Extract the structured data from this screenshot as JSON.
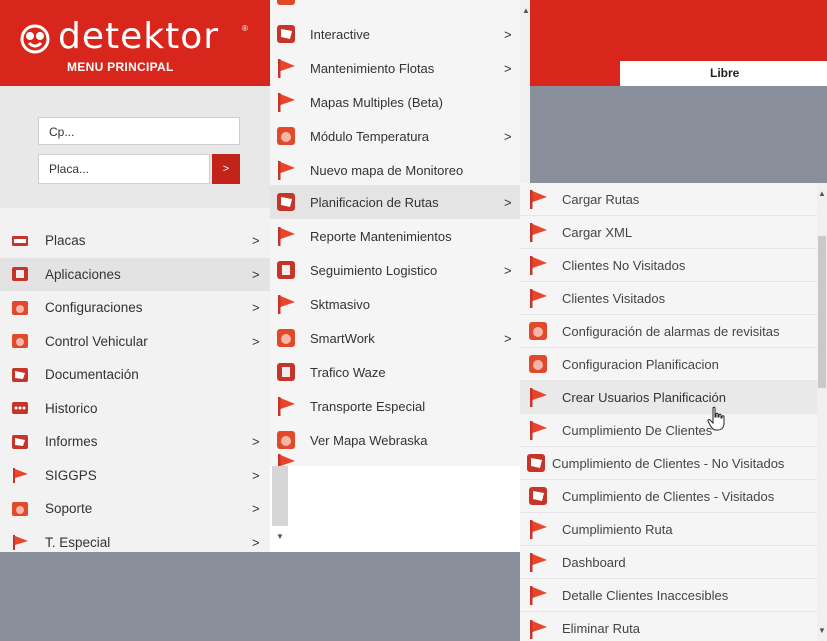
{
  "header": {
    "logo_text": "detektor",
    "logo_reg": "®",
    "subtitle": "MENU PRINCIPAL",
    "libre_label": "Libre",
    "brand_color": "#d9261c"
  },
  "search": {
    "cp_placeholder": "Cp...",
    "placa_placeholder": "Placa...",
    "go_label": ">"
  },
  "sidebar": {
    "items": [
      {
        "label": "Placas",
        "icon": "plate-icon",
        "arrow": ">"
      },
      {
        "label": "Aplicaciones",
        "icon": "box-icon",
        "arrow": ">"
      },
      {
        "label": "Configuraciones",
        "icon": "gauge-icon",
        "arrow": ">"
      },
      {
        "label": "Control Vehicular",
        "icon": "gauge-icon",
        "arrow": ">"
      },
      {
        "label": "Documentación",
        "icon": "doc-icon",
        "arrow": ""
      },
      {
        "label": "Historico",
        "icon": "dots-icon",
        "arrow": ""
      },
      {
        "label": "Informes",
        "icon": "doc-icon",
        "arrow": ">"
      },
      {
        "label": "SIGGPS",
        "icon": "flag-icon",
        "arrow": ">"
      },
      {
        "label": "Soporte",
        "icon": "gauge-icon",
        "arrow": ">"
      },
      {
        "label": "T. Especial",
        "icon": "flag-icon",
        "arrow": ">"
      }
    ]
  },
  "menu1": {
    "items": [
      {
        "label": "Interactive",
        "icon": "doc-icon",
        "arrow": ">"
      },
      {
        "label": "Mantenimiento Flotas",
        "icon": "flag-icon",
        "arrow": ">"
      },
      {
        "label": "Mapas Multiples (Beta)",
        "icon": "flag-icon",
        "arrow": ""
      },
      {
        "label": "Módulo Temperatura",
        "icon": "gauge-icon",
        "arrow": ">"
      },
      {
        "label": "Nuevo mapa de Monitoreo",
        "icon": "flag-icon",
        "arrow": ""
      },
      {
        "label": "Planificacion de Rutas",
        "icon": "doc-icon",
        "arrow": ">"
      },
      {
        "label": "Reporte Mantenimientos",
        "icon": "flag-icon",
        "arrow": ""
      },
      {
        "label": "Seguimiento Logistico",
        "icon": "box-icon",
        "arrow": ">"
      },
      {
        "label": "Sktmasivo",
        "icon": "flag-icon",
        "arrow": ""
      },
      {
        "label": "SmartWork",
        "icon": "gauge-icon",
        "arrow": ">"
      },
      {
        "label": "Trafico Waze",
        "icon": "box-icon",
        "arrow": ""
      },
      {
        "label": "Transporte Especial",
        "icon": "flag-icon",
        "arrow": ""
      },
      {
        "label": "Ver Mapa Webraska",
        "icon": "gauge-icon",
        "arrow": ""
      }
    ]
  },
  "menu2": {
    "items": [
      {
        "label": "Cargar Rutas",
        "icon": "flag-icon"
      },
      {
        "label": "Cargar XML",
        "icon": "flag-icon"
      },
      {
        "label": "Clientes No Visitados",
        "icon": "flag-icon"
      },
      {
        "label": "Clientes Visitados",
        "icon": "flag-icon"
      },
      {
        "label": "Configuración de alarmas de revisitas",
        "icon": "gauge-icon"
      },
      {
        "label": "Configuracion Planificacion",
        "icon": "gauge-icon"
      },
      {
        "label": "Crear Usuarios Planificación",
        "icon": "flag-icon"
      },
      {
        "label": "Cumplimiento De Clientes",
        "icon": "flag-icon"
      },
      {
        "label": "Cumplimiento de Clientes - No Visitados",
        "icon": "doc-icon"
      },
      {
        "label": "Cumplimiento de Clientes - Visitados",
        "icon": "doc-icon"
      },
      {
        "label": "Cumplimiento Ruta",
        "icon": "flag-icon"
      },
      {
        "label": "Dashboard",
        "icon": "flag-icon"
      },
      {
        "label": "Detalle Clientes Inaccesibles",
        "icon": "flag-icon"
      },
      {
        "label": "Eliminar Ruta",
        "icon": "flag-icon"
      }
    ]
  }
}
